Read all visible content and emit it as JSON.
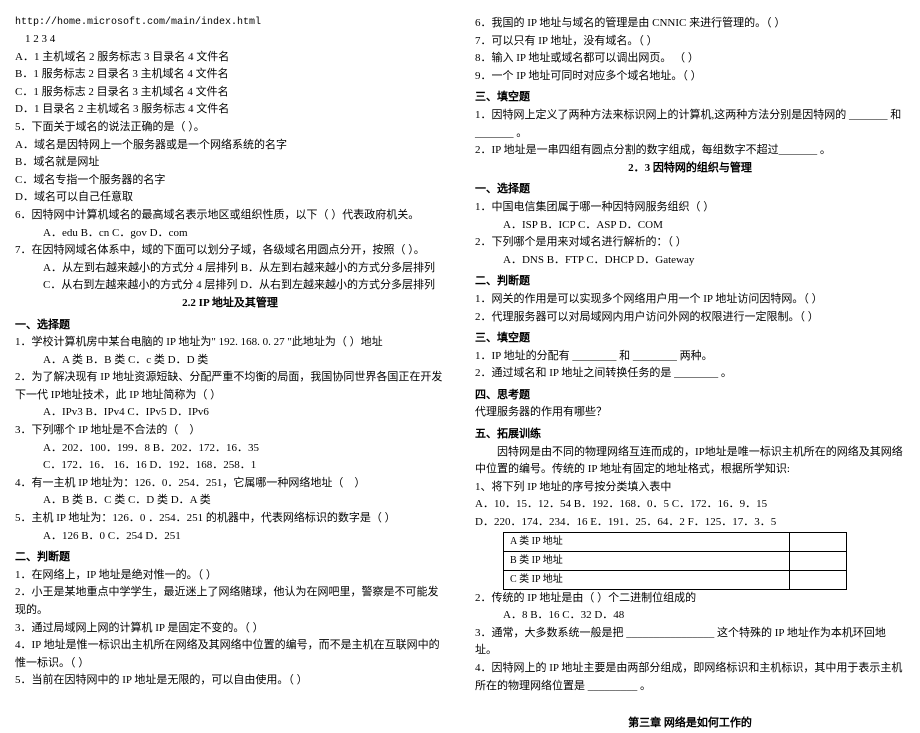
{
  "left": {
    "url": "http://home.microsoft.com/main/index.html",
    "nums": "1        2         3        4",
    "q4opts": [
      "A．1 主机域名 2 服务标志 3 目录名 4 文件名",
      "B．1 服务标志 2 目录名 3 主机域名 4 文件名",
      "C．1 服务标志 2 目录名 3 主机域名 4 文件名",
      "D．1 目录名 2 主机域名 3 服务标志 4 文件名"
    ],
    "q5": "5．下面关于域名的说法正确的是（    ）。",
    "q5opts": [
      "A．域名是因特网上一个服务器或是一个网络系统的名字",
      "B．域名就是网址",
      "C．域名专指一个服务器的名字",
      "D．域名可以自己任意取"
    ],
    "q6": "6．因特网中计算机域名的最高域名表示地区或组织性质，以下（   ）代表政府机关。",
    "q6opts": "A．edu      B．cn      C．gov      D．com",
    "q7": "7．在因特网域名体系中，域的下面可以划分子域，各级域名用圆点分开，按照（    ）。",
    "q7opts": [
      "A．从左到右越来越小的方式分 4 层排列    B．从左到右越来越小的方式分多层排列",
      "C．从右到左越来越小的方式分 4 层排列    D．从右到左越来越小的方式分多层排列"
    ],
    "sec22": "2.2 IP 地址及其管理",
    "h_select": "一、选择题",
    "s22q1": "1．学校计算机房中某台电脑的 IP 地址为\" 192. 168. 0. 27 \"此地址为（   ）地址",
    "s22q1o": "A．A 类      B．B 类      C．c 类      D．D 类",
    "s22q2": "2．为了解决现有 IP 地址资源短缺、分配严重不均衡的局面，我国协同世界各国正在开发下一代 IP地址技术，此 IP 地址简称为（   ）",
    "s22q2o": "A．IPv3     B．IPv4      C．IPv5      D．IPv6",
    "s22q3": "3．下列哪个 IP 地址是不合法的（　）",
    "s22q3o": [
      "A．202．100．199．8      B．202．172．16．35",
      "C．172．16．  16．16      D．192．168．258．1"
    ],
    "s22q4": "4．有一主机 IP 地址为：126．0．254．251，它属哪一种网络地址（　）",
    "s22q4o": "A．B 类      B．C 类      C．D 类      D．A 类",
    "s22q5": "5．主机 IP 地址为：126．0 ．254．251 的机器中，代表网络标识的数字是（   ）",
    "s22q5o": "A．126      B．0      C．254      D．251",
    "h_judge": "二、判断题",
    "j1": "1．在网络上，IP 地址是绝对惟一的。（   ）",
    "j2": "2．小王是某地重点中学学生，最近迷上了网络赌球，他认为在网吧里，警察是不可能发现的。",
    "j3": "3．通过局域网上网的计算机 IP 是固定不变的。（   ）",
    "j4": "4．IP 地址是惟一标识出主机所在网络及其网络中位置的编号，而不是主机在互联网中的惟一标识。（   ）",
    "j5": "5．当前在因特网中的 IP 地址是无限的，可以自由使用。（   ）"
  },
  "right": {
    "j6": "6．我国的 IP 地址与域名的管理是由 CNNIC 来进行管理的。（   ）",
    "j7": "7．可以只有 IP 地址，没有域名。（   ）",
    "j8": "8．输入 IP 地址或域名都可以调出网页。  （   ）",
    "j9": "9．一个 IP 地址可同时对应多个域名地址。（   ）",
    "h_fill": "三、填空题",
    "f1": "1．因特网上定义了两种方法来标识网上的计算机,这两种方法分别是因特网的 _______ 和 _______ 。",
    "f2": "2．IP 地址是一串四组有圆点分割的数字组成，每组数字不超过_______ 。",
    "sec23": "2．3 因特网的组织与管理",
    "h_select2": "一、选择题",
    "s23q1": "1．中国电信集团属于哪一种因特网服务组织（   ）",
    "s23q1o": "A．ISP      B．ICP      C．ASP    D．COM",
    "s23q2": "2．下列哪个是用来对域名进行解析的：（    ）",
    "s23q2o": "A．DNS      B．FTP      C．DHCP    D．Gateway",
    "h_judge2": "二、判断题",
    "jd1": "1．网关的作用是可以实现多个网络用户用一个 IP 地址访问因特网。（   ）",
    "jd2": "2．代理服务器可以对局域网内用户访问外网的权限进行一定限制。（   ）",
    "h_fill2": "三、填空题",
    "ff1": "1．IP 地址的分配有 ________ 和 ________ 两种。",
    "ff2": "2．通过域名和 IP 地址之间转换任务的是 ________ 。",
    "h_think": "四、思考题",
    "tq": "代理服务器的作用有哪些？",
    "h_ext": "五、拓展训练",
    "ext_intro": "　　因特网是由不同的物理网络互连而成的，IP地址是唯一标识主机所在的网络及其网络中位置的编号。传统的 IP 地址有固定的地址格式，根据所学知识:",
    "eq1": "1、将下列 IP 地址的序号按分类填入表中",
    "eq1o": [
      "A．10．15．12．54        B．192．168．0．5     C．172．16．9．15",
      "D．220．174．234．16     E．191．25．64．2     F．125．17．3．5"
    ],
    "trows": [
      "A 类 IP 地址",
      "B 类 IP 地址",
      "C 类 IP 地址"
    ],
    "eq2": "2．传统的 IP 地址是由（        ）个二进制位组成的",
    "eq2o": "A．8      B．16      C．32      D．48",
    "eq3": "3．通常，大多数系统一般是把 ________________ 这个特殊的 IP 地址作为本机环回地址。",
    "eq4": "4．因特网上的 IP 地址主要是由两部分组成，即网络标识和主机标识，其中用于表示主机所在的物理网络位置是 _________ 。",
    "chapter3": "第三章  网络是如何工作的"
  }
}
